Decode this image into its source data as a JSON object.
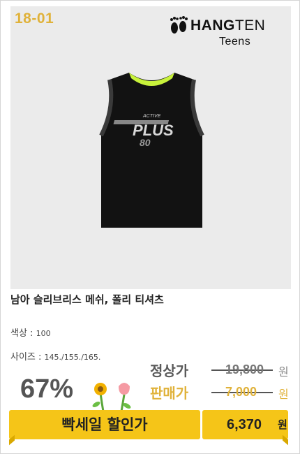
{
  "item_code": "18-01",
  "brand": {
    "name_bold": "HANG",
    "name_thin": "TEN",
    "sub": "Teens"
  },
  "product": {
    "name": "남아 슬리브리스 메쉬, 폴리 티셔츠",
    "color_label": "색상 : ",
    "color_value": "100",
    "size_label": "사이즈 : ",
    "size_value": "145./155./165."
  },
  "pricing": {
    "discount": "67%",
    "regular_label": "정상가",
    "regular_price": "19,800",
    "sale_label": "판매가",
    "sale_price": "7,000",
    "won": "원",
    "promo_label": "빡세일 할인가",
    "final_price": "6,370",
    "final_won": "원"
  },
  "colors": {
    "accent": "#f5c518",
    "code": "#e0b23a",
    "shirt": "#121212",
    "collar": "#c8f23b"
  }
}
